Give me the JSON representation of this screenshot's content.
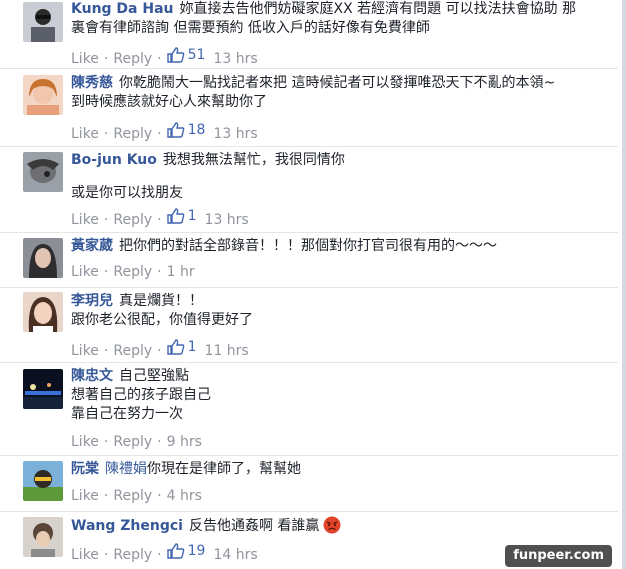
{
  "comments": [
    {
      "author": "Kung Da Hau",
      "lines": [
        "妳直接去告他們妨礙家庭XX 若經濟有問題 可以找法扶會協助 那",
        "裏會有律師諮詢 但需要預約 低收入戶的話好像有免費律師"
      ],
      "actions": {
        "like": "Like",
        "reply": "Reply",
        "likes": "51",
        "time": "13 hrs"
      }
    },
    {
      "author": "陳秀慈",
      "lines": [
        "你乾脆鬧大一點找記者來把 這時候記者可以發揮唯恐天下不亂的本領~",
        "到時候應該就好心人來幫助你了"
      ],
      "actions": {
        "like": "Like",
        "reply": "Reply",
        "likes": "18",
        "time": "13 hrs"
      }
    },
    {
      "author": "Bo-jun Kuo",
      "lines": [
        "我想我無法幫忙，我很同情你",
        "",
        "或是你可以找朋友"
      ],
      "actions": {
        "like": "Like",
        "reply": "Reply",
        "likes": "1",
        "time": "13 hrs"
      }
    },
    {
      "author": "黃家葳",
      "lines": [
        "把你們的對話全部錄音！！！那個對你打官司很有用的～～～"
      ],
      "actions": {
        "like": "Like",
        "reply": "Reply",
        "likes": "",
        "time": "1 hr"
      }
    },
    {
      "author": "李玥兒",
      "lines": [
        "真是爛貨！！",
        "跟你老公很配，你值得更好了"
      ],
      "actions": {
        "like": "Like",
        "reply": "Reply",
        "likes": "1",
        "time": "11 hrs"
      }
    },
    {
      "author": "陳忠文",
      "lines": [
        "自己堅強點",
        "想著自己的孩子跟自己",
        "靠自己在努力一次"
      ],
      "actions": {
        "like": "Like",
        "reply": "Reply",
        "likes": "",
        "time": "9 hrs"
      }
    },
    {
      "author": "阮棠",
      "mention": "陳禮娟",
      "lines": [
        "你現在是律師了，幫幫她"
      ],
      "actions": {
        "like": "Like",
        "reply": "Reply",
        "likes": "",
        "time": "4 hrs"
      }
    },
    {
      "author": "Wang Zhengci",
      "lines": [
        "反告他通姦啊 看誰贏"
      ],
      "actions": {
        "like": "Like",
        "reply": "Reply",
        "likes": "19",
        "time": "14 hrs"
      }
    }
  ],
  "watermark": "funpeer.com",
  "colors": {
    "author": "#365899",
    "meta": "#90949c",
    "like_count": "#4267b2"
  },
  "icons": {
    "like": "thumbs-up-icon",
    "angry": "angry-face-emoji"
  }
}
